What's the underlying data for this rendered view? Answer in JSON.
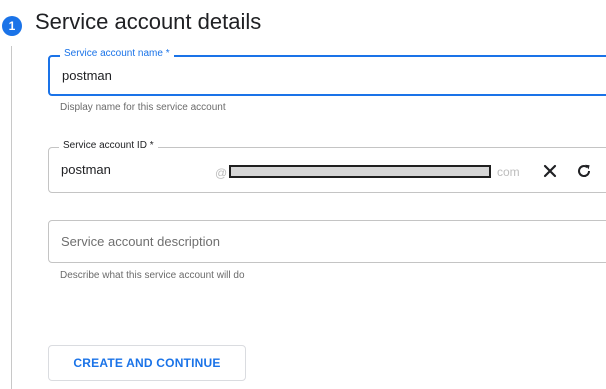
{
  "step": {
    "number": "1",
    "title": "Service account details"
  },
  "form": {
    "name_field": {
      "label": "Service account name *",
      "value": "postman",
      "hint": "Display name for this service account"
    },
    "id_field": {
      "label": "Service account ID *",
      "value": "postman",
      "at_sign": "@",
      "domain_suffix": "com",
      "clear_icon": "close-icon",
      "refresh_icon": "refresh-icon"
    },
    "description_field": {
      "placeholder": "Service account description",
      "hint": "Describe what this service account will do"
    }
  },
  "actions": {
    "create_and_continue": "CREATE AND CONTINUE"
  },
  "colors": {
    "accent": "#1a73e8",
    "border": "#c4c4c4",
    "hint_text": "#6b6b6b"
  }
}
